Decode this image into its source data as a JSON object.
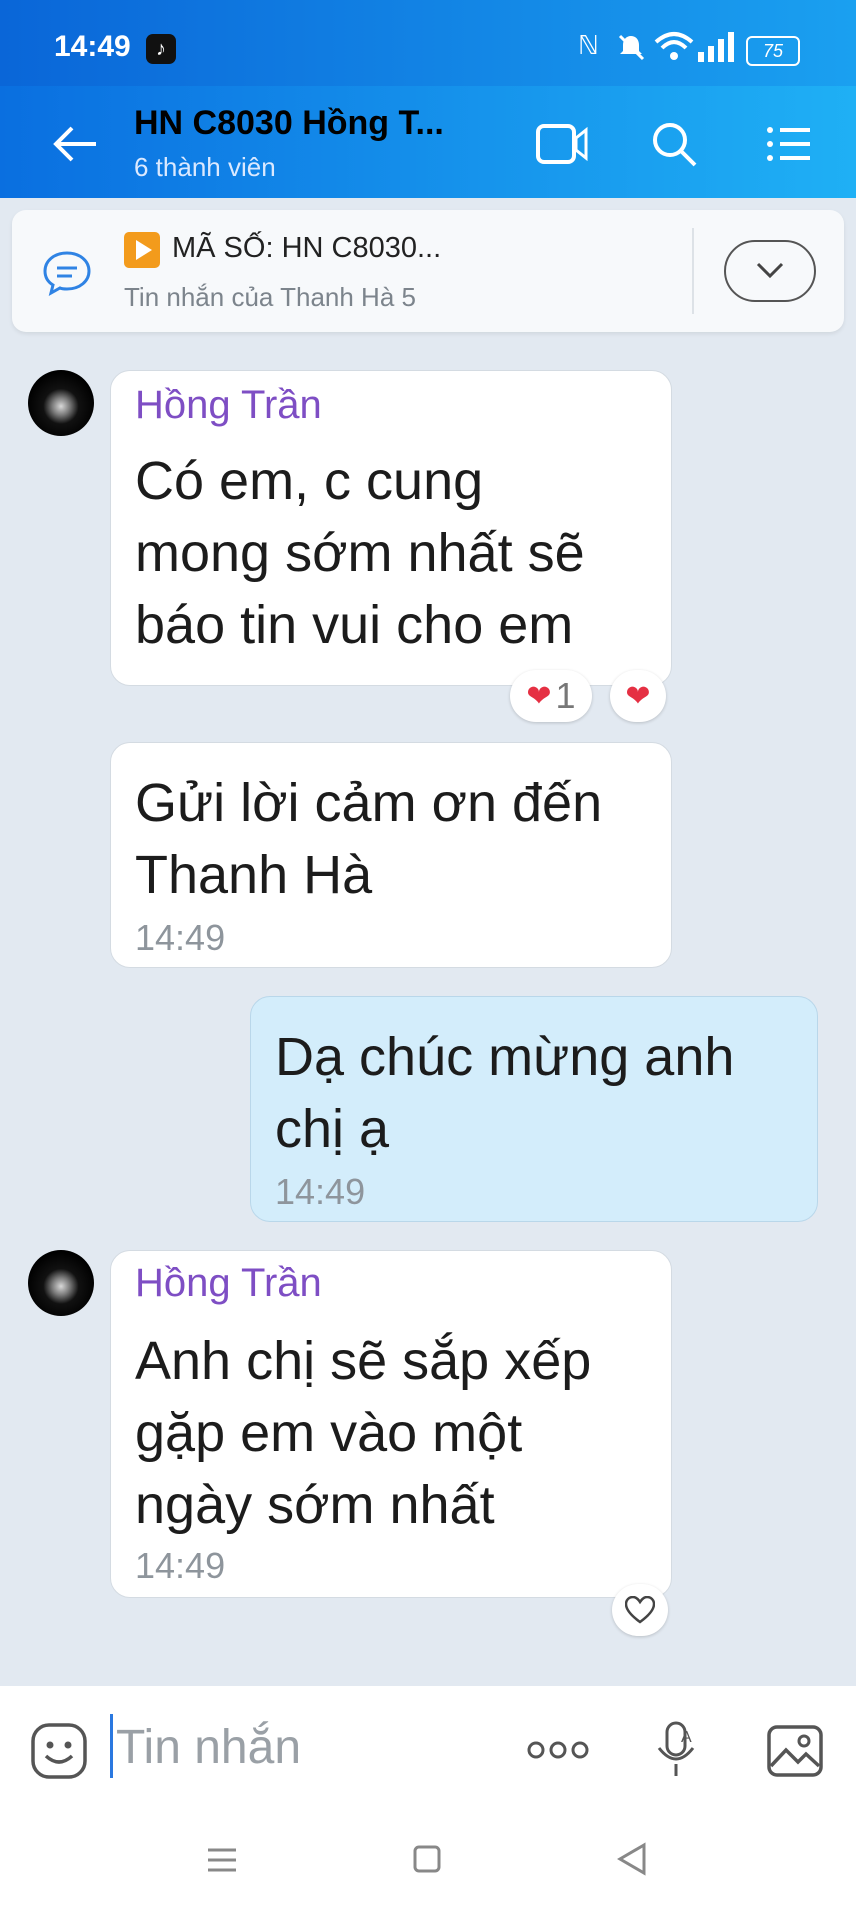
{
  "status_bar": {
    "time": "14:49",
    "battery": "75"
  },
  "header": {
    "title": "HN C8030 Hồng T...",
    "subtitle": "6 thành viên"
  },
  "pinned": {
    "title": "MÃ SỐ: HN C8030...",
    "subtitle": "Tin nhắn của Thanh Hà 5"
  },
  "messages": [
    {
      "sender": "Hồng Trần",
      "lines": [
        "Có em, c cung",
        "mong sớm nhất sẽ",
        "báo tin vui cho em"
      ],
      "reaction_count": "1"
    },
    {
      "lines": [
        "Gửi lời cảm ơn đến",
        "Thanh Hà"
      ],
      "time": "14:49"
    },
    {
      "lines": [
        "Dạ chúc mừng anh",
        "chị ạ"
      ],
      "time": "14:49"
    },
    {
      "sender": "Hồng Trần",
      "lines": [
        "Anh chị sẽ sắp xếp",
        "gặp em vào một",
        "ngày sớm nhất"
      ],
      "time": "14:49"
    }
  ],
  "input": {
    "placeholder": "Tin nhắn"
  },
  "icons": {
    "back": "back-arrow-icon",
    "video": "video-call-icon",
    "search": "search-icon",
    "menu": "list-menu-icon",
    "pinned": "chat-bubble-icon",
    "expand": "chevron-down-icon",
    "sticker": "emoji-icon",
    "more": "more-dots-icon",
    "voice": "microphone-icon",
    "image": "image-icon"
  },
  "colors": {
    "header": "#0a6fe0",
    "sender": "#7e4ec4",
    "outgoing_bubble": "#d3edfb",
    "background": "#e2e9f1"
  }
}
